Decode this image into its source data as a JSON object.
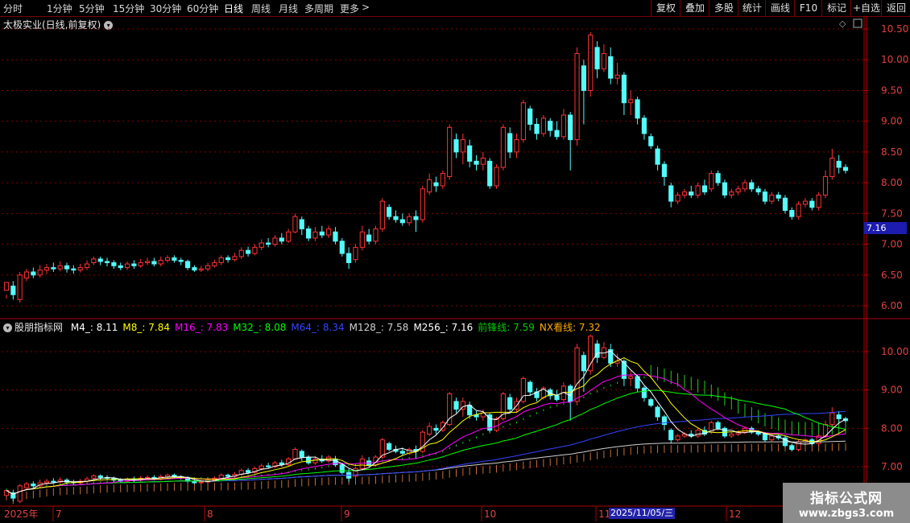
{
  "toolbar": {
    "periods": [
      "分时",
      "1分钟",
      "5分钟",
      "15分钟",
      "30分钟",
      "60分钟",
      "日线",
      "周线",
      "月线",
      "多周期",
      "更多"
    ],
    "active_period": "日线",
    "more_arrow": ">",
    "buttons": [
      "复权",
      "叠加",
      "多股",
      "统计",
      "画线",
      "F10",
      "标记",
      "+自选",
      "返回"
    ]
  },
  "main_panel": {
    "title": "太极实业(日线,前复权)",
    "current_price_tag": "7.16",
    "y_ticks": [
      "10.50",
      "10.00",
      "9.50",
      "9.00",
      "8.50",
      "8.00",
      "7.50",
      "7.00",
      "6.50",
      "6.00"
    ]
  },
  "indicator_panel": {
    "name": "股朋指标网",
    "values": [
      {
        "label": "M4_: 8.11",
        "color": "#ffffff"
      },
      {
        "label": "M8_: 7.84",
        "color": "#ffff00"
      },
      {
        "label": "M16_: 7.83",
        "color": "#ff00ff"
      },
      {
        "label": "M32_: 8.08",
        "color": "#00ff00"
      },
      {
        "label": "M64_: 8.34",
        "color": "#3344ff"
      },
      {
        "label": "M128_: 7.58",
        "color": "#d0d0d0"
      },
      {
        "label": "M256_: 7.16",
        "color": "#ffffff"
      },
      {
        "label": "前锋线: 7.59",
        "color": "#00cc00"
      },
      {
        "label": "NX看线: 7.32",
        "color": "#ffaa00"
      }
    ],
    "y_ticks": [
      "10.00",
      "9.00",
      "8.00",
      "7.00"
    ]
  },
  "date_axis": {
    "labels": [
      "2025年",
      "7",
      "8",
      "9",
      "10",
      "11",
      "12"
    ],
    "highlight": "2025/11/05/三"
  },
  "watermark": {
    "line1": "指标公式网",
    "line2": "www.zbgs3.com"
  },
  "chart_data": {
    "type": "candlestick",
    "title": "太极实业(日线,前复权)",
    "ylim": [
      5.9,
      10.7
    ],
    "candles": [
      [
        6.25,
        6.38,
        6.18,
        6.12
      ],
      [
        6.32,
        6.18,
        6.4,
        6.1
      ],
      [
        6.1,
        6.5,
        6.55,
        6.05
      ],
      [
        6.45,
        6.55,
        6.6,
        6.4
      ],
      [
        6.55,
        6.5,
        6.62,
        6.45
      ],
      [
        6.5,
        6.58,
        6.66,
        6.46
      ],
      [
        6.58,
        6.62,
        6.68,
        6.52
      ],
      [
        6.62,
        6.6,
        6.7,
        6.55
      ],
      [
        6.6,
        6.65,
        6.72,
        6.56
      ],
      [
        6.65,
        6.6,
        6.7,
        6.54
      ],
      [
        6.6,
        6.58,
        6.66,
        6.52
      ],
      [
        6.58,
        6.62,
        6.68,
        6.54
      ],
      [
        6.62,
        6.68,
        6.74,
        6.58
      ],
      [
        6.7,
        6.76,
        6.8,
        6.66
      ],
      [
        6.76,
        6.72,
        6.8,
        6.66
      ],
      [
        6.72,
        6.7,
        6.78,
        6.64
      ],
      [
        6.7,
        6.65,
        6.74,
        6.6
      ],
      [
        6.65,
        6.62,
        6.7,
        6.58
      ],
      [
        6.62,
        6.68,
        6.72,
        6.58
      ],
      [
        6.68,
        6.65,
        6.74,
        6.6
      ],
      [
        6.65,
        6.7,
        6.76,
        6.62
      ],
      [
        6.7,
        6.72,
        6.78,
        6.66
      ],
      [
        6.72,
        6.68,
        6.78,
        6.64
      ],
      [
        6.68,
        6.74,
        6.8,
        6.64
      ],
      [
        6.74,
        6.78,
        6.82,
        6.7
      ],
      [
        6.78,
        6.74,
        6.82,
        6.7
      ],
      [
        6.74,
        6.72,
        6.78,
        6.66
      ],
      [
        6.72,
        6.62,
        6.75,
        6.58
      ],
      [
        6.62,
        6.58,
        6.66,
        6.55
      ],
      [
        6.58,
        6.6,
        6.65,
        6.55
      ],
      [
        6.6,
        6.65,
        6.7,
        6.56
      ],
      [
        6.65,
        6.7,
        6.75,
        6.62
      ],
      [
        6.7,
        6.78,
        6.82,
        6.66
      ],
      [
        6.78,
        6.75,
        6.82,
        6.7
      ],
      [
        6.75,
        6.8,
        6.86,
        6.72
      ],
      [
        6.8,
        6.9,
        6.95,
        6.76
      ],
      [
        6.9,
        6.85,
        6.96,
        6.8
      ],
      [
        6.85,
        6.95,
        7.0,
        6.82
      ],
      [
        6.95,
        7.02,
        7.08,
        6.9
      ],
      [
        7.02,
        7.0,
        7.1,
        6.95
      ],
      [
        7.0,
        7.1,
        7.15,
        6.96
      ],
      [
        7.1,
        7.05,
        7.18,
        7.0
      ],
      [
        7.05,
        7.2,
        7.25,
        7.02
      ],
      [
        7.2,
        7.45,
        7.5,
        7.18
      ],
      [
        7.4,
        7.25,
        7.45,
        7.15
      ],
      [
        7.25,
        7.1,
        7.3,
        7.05
      ],
      [
        7.1,
        7.2,
        7.28,
        7.05
      ],
      [
        7.2,
        7.15,
        7.3,
        7.1
      ],
      [
        7.15,
        7.25,
        7.3,
        7.1
      ],
      [
        7.2,
        7.05,
        7.28,
        7.0
      ],
      [
        7.05,
        6.85,
        7.1,
        6.8
      ],
      [
        6.85,
        6.7,
        6.95,
        6.6
      ],
      [
        6.75,
        6.95,
        7.0,
        6.7
      ],
      [
        6.95,
        7.2,
        7.3,
        6.9
      ],
      [
        7.15,
        7.05,
        7.25,
        7.0
      ],
      [
        7.05,
        7.25,
        7.3,
        7.0
      ],
      [
        7.25,
        7.7,
        7.75,
        7.2
      ],
      [
        7.6,
        7.45,
        7.65,
        7.4
      ],
      [
        7.45,
        7.4,
        7.55,
        7.35
      ],
      [
        7.4,
        7.35,
        7.5,
        7.3
      ],
      [
        7.35,
        7.45,
        7.5,
        7.3
      ],
      [
        7.45,
        7.4,
        7.55,
        7.2
      ],
      [
        7.4,
        7.9,
        7.95,
        7.35
      ],
      [
        7.85,
        8.05,
        8.15,
        7.8
      ],
      [
        8.0,
        7.95,
        8.1,
        7.85
      ],
      [
        7.95,
        8.15,
        8.2,
        7.9
      ],
      [
        8.1,
        8.9,
        8.95,
        8.05
      ],
      [
        8.7,
        8.5,
        8.8,
        8.4
      ],
      [
        8.5,
        8.7,
        8.8,
        8.3
      ],
      [
        8.6,
        8.35,
        8.7,
        8.25
      ],
      [
        8.35,
        8.3,
        8.45,
        8.2
      ],
      [
        8.3,
        8.4,
        8.5,
        8.2
      ],
      [
        8.35,
        7.95,
        8.4,
        7.9
      ],
      [
        7.95,
        8.25,
        8.3,
        7.9
      ],
      [
        8.25,
        8.9,
        8.95,
        8.2
      ],
      [
        8.8,
        8.5,
        8.9,
        8.4
      ],
      [
        8.5,
        8.7,
        8.8,
        8.4
      ],
      [
        8.7,
        9.3,
        9.35,
        8.65
      ],
      [
        9.2,
        8.95,
        9.25,
        8.85
      ],
      [
        8.95,
        8.8,
        9.05,
        8.7
      ],
      [
        8.8,
        9.05,
        9.1,
        8.75
      ],
      [
        9.0,
        8.85,
        9.05,
        8.75
      ],
      [
        8.85,
        8.75,
        9.0,
        8.7
      ],
      [
        8.75,
        9.1,
        9.2,
        8.7
      ],
      [
        9.1,
        8.7,
        9.15,
        8.2
      ],
      [
        8.7,
        10.1,
        10.2,
        8.6
      ],
      [
        9.9,
        9.5,
        10.0,
        8.95
      ],
      [
        9.5,
        10.4,
        10.45,
        9.4
      ],
      [
        10.2,
        9.85,
        10.3,
        9.7
      ],
      [
        9.85,
        10.1,
        10.25,
        9.8
      ],
      [
        10.05,
        9.7,
        10.2,
        9.6
      ],
      [
        9.7,
        9.75,
        9.95,
        9.6
      ],
      [
        9.75,
        9.3,
        9.8,
        9.1
      ],
      [
        9.3,
        9.35,
        9.5,
        9.1
      ],
      [
        9.35,
        9.05,
        9.4,
        8.95
      ],
      [
        9.05,
        8.8,
        9.1,
        8.7
      ],
      [
        8.75,
        8.6,
        8.8,
        8.55
      ],
      [
        8.55,
        8.3,
        8.6,
        8.2
      ],
      [
        8.3,
        8.1,
        8.35,
        7.95
      ],
      [
        7.95,
        7.7,
        8.0,
        7.6
      ],
      [
        7.7,
        7.8,
        7.85,
        7.65
      ],
      [
        7.8,
        7.85,
        7.9,
        7.75
      ],
      [
        7.85,
        7.8,
        7.95,
        7.75
      ],
      [
        7.8,
        7.95,
        8.0,
        7.75
      ],
      [
        7.95,
        7.85,
        8.05,
        7.8
      ],
      [
        7.9,
        8.15,
        8.2,
        7.85
      ],
      [
        8.15,
        8.0,
        8.2,
        7.95
      ],
      [
        8.0,
        7.8,
        8.05,
        7.75
      ],
      [
        7.8,
        7.85,
        7.9,
        7.75
      ],
      [
        7.85,
        7.9,
        7.95,
        7.8
      ],
      [
        7.9,
        8.0,
        8.05,
        7.85
      ],
      [
        8.0,
        7.9,
        8.05,
        7.85
      ],
      [
        7.9,
        7.85,
        7.95,
        7.8
      ],
      [
        7.85,
        7.7,
        7.9,
        7.65
      ],
      [
        7.7,
        7.8,
        7.85,
        7.65
      ],
      [
        7.8,
        7.75,
        7.85,
        7.7
      ],
      [
        7.75,
        7.55,
        7.8,
        7.5
      ],
      [
        7.55,
        7.45,
        7.6,
        7.4
      ],
      [
        7.45,
        7.65,
        7.7,
        7.4
      ],
      [
        7.65,
        7.7,
        7.75,
        7.6
      ],
      [
        7.7,
        7.6,
        7.75,
        7.55
      ],
      [
        7.6,
        7.8,
        7.85,
        7.55
      ],
      [
        7.8,
        8.1,
        8.2,
        7.75
      ],
      [
        8.1,
        8.4,
        8.55,
        8.05
      ],
      [
        8.35,
        8.25,
        8.45,
        8.15
      ],
      [
        8.25,
        8.2,
        8.3,
        8.15
      ]
    ]
  }
}
